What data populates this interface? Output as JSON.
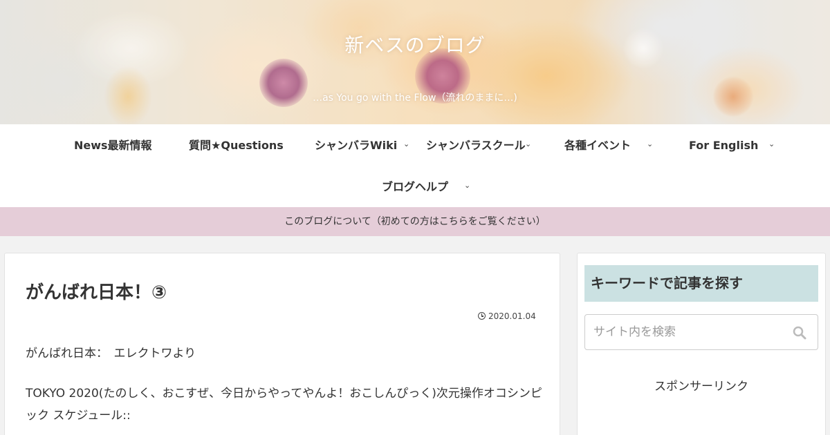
{
  "header": {
    "site_title": "新ベスのブログ",
    "tagline": "…as You go with the Flow（流れのままに…)"
  },
  "nav": {
    "items": [
      {
        "label": "News最新情報",
        "has_dropdown": false
      },
      {
        "label": "質問★Questions",
        "has_dropdown": false
      },
      {
        "label": "シャンバラWiki",
        "has_dropdown": true
      },
      {
        "label": "シャンバラスクール",
        "has_dropdown": true
      },
      {
        "label": "各種イベント",
        "has_dropdown": true
      },
      {
        "label": "For English",
        "has_dropdown": true
      },
      {
        "label": "ブログヘルプ",
        "has_dropdown": true
      }
    ]
  },
  "notice": {
    "text": "このブログについて（初めての方はこちらをご覧ください）",
    "background": "#e5cdd8"
  },
  "post": {
    "title": "がんばれ日本！③",
    "date": "2020.01.04",
    "paragraph1": "がんばれ日本：　エレクトワより",
    "paragraph2": "TOKYO 2020(たのしく、おこすぜ、今日からやってやんよ！おこしんぴっく)次元操作オコシンピック スケジュール::"
  },
  "sidebar": {
    "widget_title": "キーワードで記事を探す",
    "widget_title_background": "#cbe1e2",
    "search_placeholder": "サイト内を検索",
    "search_icon": "search-icon",
    "sponsor_label": "スポンサーリンク"
  }
}
